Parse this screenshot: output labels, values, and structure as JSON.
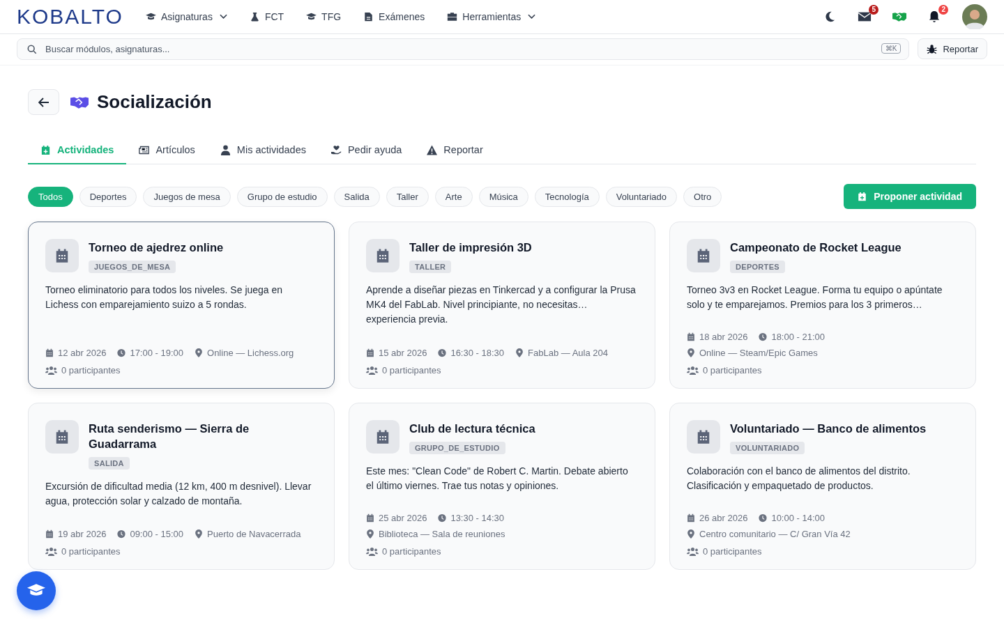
{
  "brand": "KOBALTO",
  "nav": [
    {
      "label": "Asignaturas",
      "kind": "cap",
      "dropdown": true
    },
    {
      "label": "FCT",
      "kind": "flask",
      "dropdown": false
    },
    {
      "label": "TFG",
      "kind": "cap",
      "dropdown": false
    },
    {
      "label": "Exámenes",
      "kind": "doc",
      "dropdown": false
    },
    {
      "label": "Herramientas",
      "kind": "toolbox",
      "dropdown": true
    }
  ],
  "header_badges": {
    "messages": "5",
    "notifications": "2"
  },
  "search": {
    "placeholder": "Buscar módulos, asignaturas...",
    "shortcut": "⌘K"
  },
  "report_button": "Reportar",
  "page_title": "Socialización",
  "tabs": [
    {
      "label": "Actividades",
      "kind": "calplus",
      "selected": true
    },
    {
      "label": "Artículos",
      "kind": "news",
      "selected": false
    },
    {
      "label": "Mis actividades",
      "kind": "user",
      "selected": false
    },
    {
      "label": "Pedir ayuda",
      "kind": "help",
      "selected": false
    },
    {
      "label": "Reportar",
      "kind": "warn",
      "selected": false
    }
  ],
  "filters": [
    {
      "label": "Todos",
      "selected": true
    },
    {
      "label": "Deportes",
      "selected": false
    },
    {
      "label": "Juegos de mesa",
      "selected": false
    },
    {
      "label": "Grupo de estudio",
      "selected": false
    },
    {
      "label": "Salida",
      "selected": false
    },
    {
      "label": "Taller",
      "selected": false
    },
    {
      "label": "Arte",
      "selected": false
    },
    {
      "label": "Música",
      "selected": false
    },
    {
      "label": "Tecnología",
      "selected": false
    },
    {
      "label": "Voluntariado",
      "selected": false
    },
    {
      "label": "Otro",
      "selected": false
    }
  ],
  "propose_button": "Proponer actividad",
  "activities": [
    {
      "title": "Torneo de ajedrez online",
      "tag": "JUEGOS_DE_MESA",
      "description": "Torneo eliminatorio para todos los niveles. Se juega en Lichess con emparejamiento suizo a 5 rondas.",
      "date": "12 abr 2026",
      "time": "17:00 - 19:00",
      "location": "Online — Lichess.org",
      "participants": "0 participantes",
      "highlighted": true
    },
    {
      "title": "Taller de impresión 3D",
      "tag": "TALLER",
      "description": "Aprende a diseñar piezas en Tinkercad y a configurar la Prusa MK4 del FabLab. Nivel principiante, no necesitas… experiencia previa.",
      "date": "15 abr 2026",
      "time": "16:30 - 18:30",
      "location": "FabLab — Aula 204",
      "participants": "0 participantes",
      "highlighted": false
    },
    {
      "title": "Campeonato de Rocket League",
      "tag": "DEPORTES",
      "description": "Torneo 3v3 en Rocket League. Forma tu equipo o apúntate solo y te emparejamos. Premios para los 3 primeros…",
      "date": "18 abr 2026",
      "time": "18:00 - 21:00",
      "location": "Online — Steam/Epic Games",
      "participants": "0 participantes",
      "highlighted": false
    },
    {
      "title": "Ruta senderismo — Sierra de Guadarrama",
      "tag": "SALIDA",
      "description": "Excursión de dificultad media (12 km, 400 m desnivel). Llevar agua, protección solar y calzado de montaña.",
      "date": "19 abr 2026",
      "time": "09:00 - 15:00",
      "location": "Puerto de Navacerrada",
      "participants": "0 participantes",
      "highlighted": false
    },
    {
      "title": "Club de lectura técnica",
      "tag": "GRUPO_DE_ESTUDIO",
      "description": "Este mes: \"Clean Code\" de Robert C. Martin. Debate abierto el último viernes. Trae tus notas y opiniones.",
      "date": "25 abr 2026",
      "time": "13:30 - 14:30",
      "location": "Biblioteca — Sala de reuniones",
      "participants": "0 participantes",
      "highlighted": false
    },
    {
      "title": "Voluntariado — Banco de alimentos",
      "tag": "VOLUNTARIADO",
      "description": "Colaboración con el banco de alimentos del distrito. Clasificación y empaquetado de productos.",
      "date": "26 abr 2026",
      "time": "10:00 - 14:00",
      "location": "Centro comunitario — C/ Gran Vía 42",
      "participants": "0 participantes",
      "highlighted": false
    }
  ]
}
